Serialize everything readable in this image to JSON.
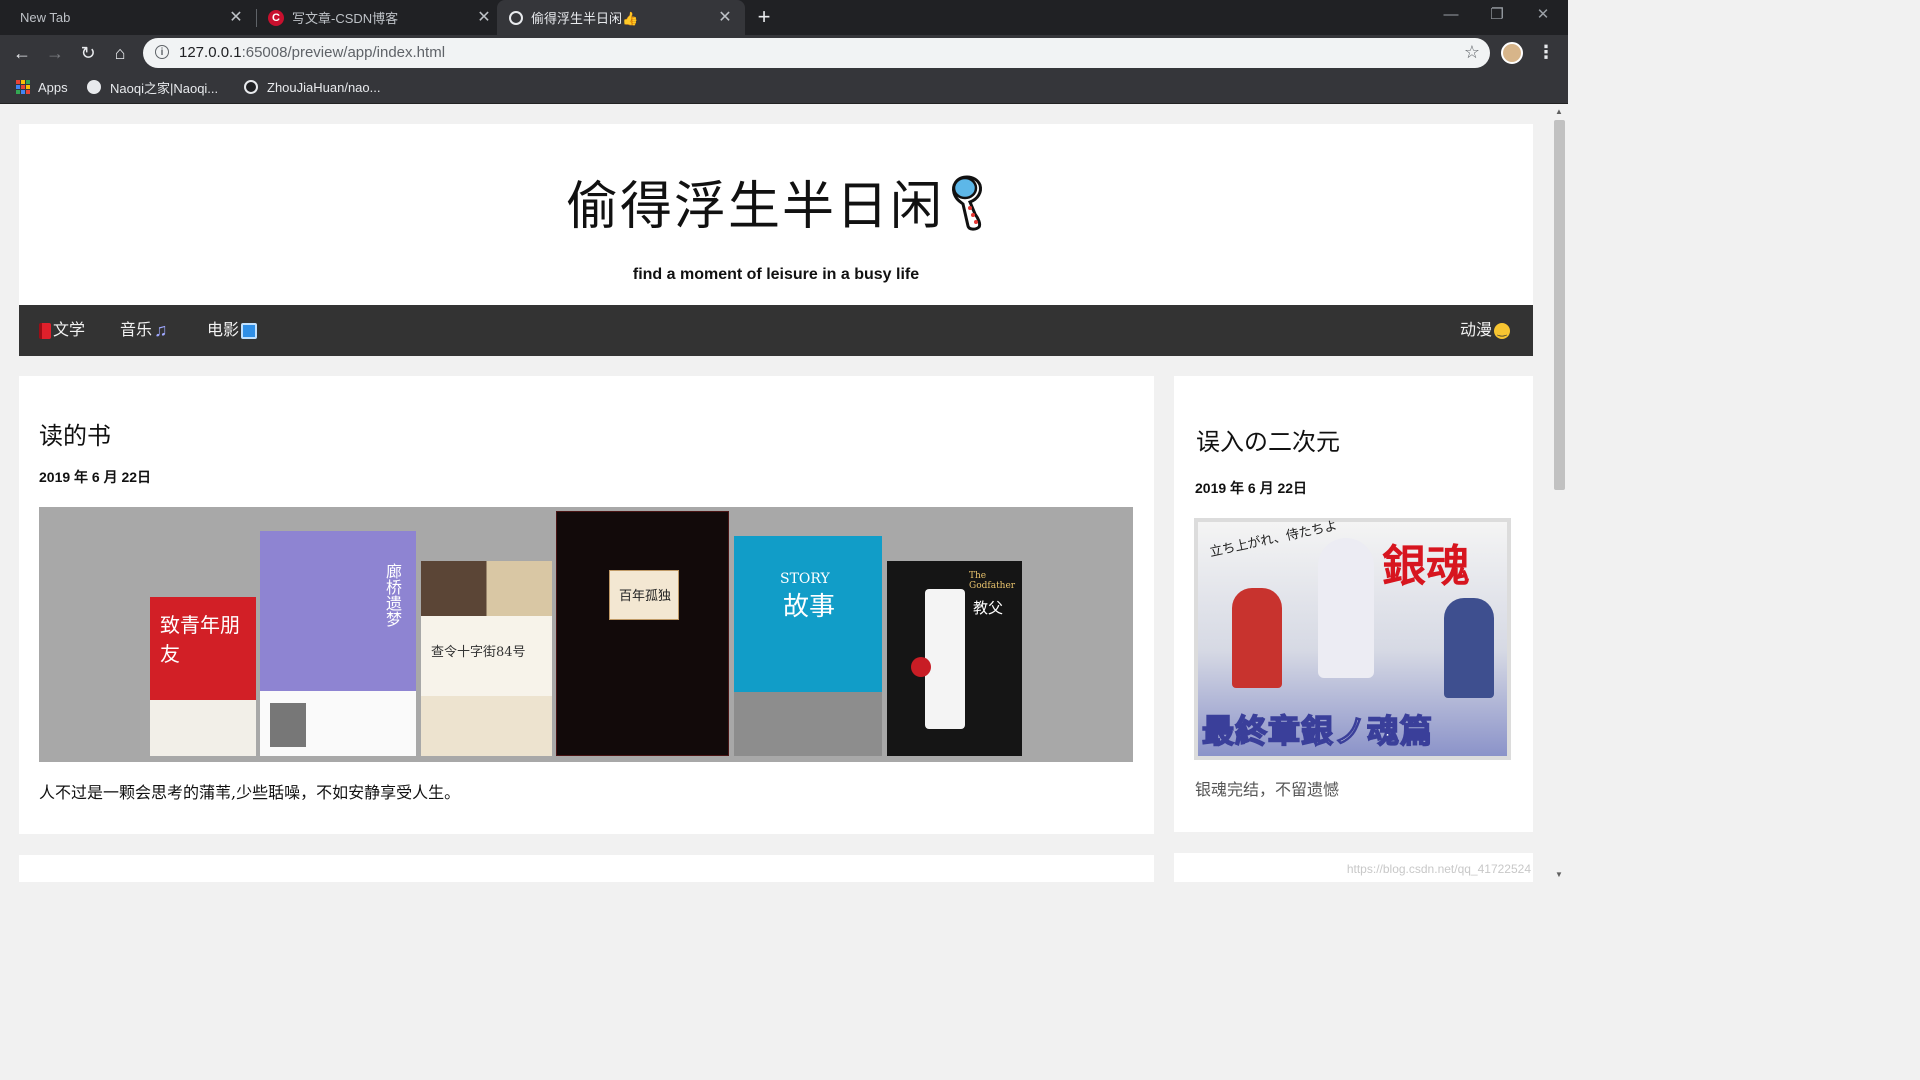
{
  "browser": {
    "tabs": [
      {
        "title": "New Tab",
        "active": false
      },
      {
        "title": "写文章-CSDN博客",
        "active": false
      },
      {
        "title": "偷得浮生半日闲👍",
        "active": true
      }
    ],
    "url_host": "127.0.0.1",
    "url_rest": ":65008/preview/app/index.html",
    "bookmarks": [
      {
        "label": "Apps"
      },
      {
        "label": "Naoqi之家|Naoqi..."
      },
      {
        "label": "ZhouJiaHuan/nao..."
      }
    ]
  },
  "header": {
    "title": "偷得浮生半日闲",
    "subtitle": "find a moment of leisure in a busy life"
  },
  "nav": {
    "items": [
      {
        "label": "文学",
        "icon": "red-book-icon"
      },
      {
        "label": "音乐",
        "icon": "music-note-icon"
      },
      {
        "label": "电影",
        "icon": "film-icon"
      }
    ],
    "right_item": {
      "label": "动漫",
      "icon": "smiley-icon"
    }
  },
  "main_post": {
    "title": "读的书",
    "date": "2019 年 6 月 22日",
    "description": "人不过是一颗会思考的蒲苇,少些聒噪，不如安静享受人生。",
    "book_texts": {
      "book1": "致青年朋友",
      "book2": "廊桥遗梦",
      "book3": "查令十字街84号",
      "book4": "百年孤独",
      "book5_en": "STORY",
      "book5": "故事",
      "book6_en": "The Godfather",
      "book6": "教父"
    }
  },
  "side_post": {
    "title": "误入の二次元",
    "date": "2019 年 6 月 22日",
    "description": "银魂完结，不留遗憾",
    "poster_texts": {
      "top": "立ち上がれ、侍たちよ",
      "logo": "銀魂",
      "bottom": "最終章銀ノ魂篇"
    }
  },
  "watermark": "https://blog.csdn.net/qq_41722524",
  "colors": {
    "chrome_dark": "#202124",
    "chrome_toolbar": "#35363a",
    "nav_bar": "#333333",
    "page_bg": "#f1f1f1"
  }
}
